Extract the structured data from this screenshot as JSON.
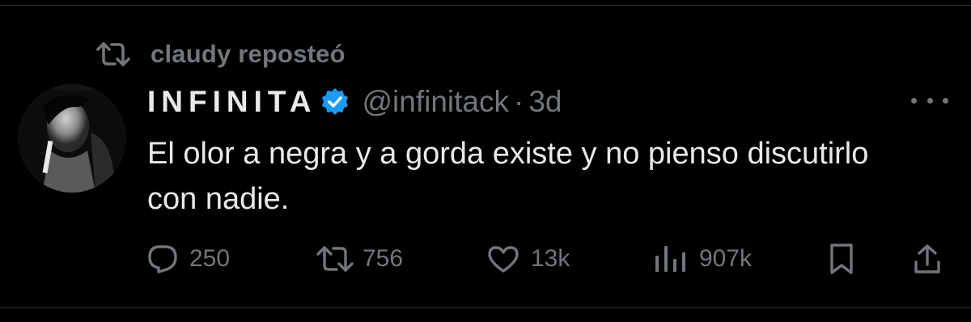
{
  "repost": {
    "label": "claudy reposteó",
    "icon": "repost-icon"
  },
  "tweet": {
    "author_name": "INFINITA",
    "handle": "@infinitack",
    "separator": "·",
    "time": "3d",
    "verified": true,
    "text": "El olor a negra y a gorda existe y no pienso discutirlo con nadie."
  },
  "actions": {
    "replies": "250",
    "reposts": "756",
    "likes": "13k",
    "views": "907k"
  },
  "colors": {
    "background": "#000000",
    "primary_text": "#e7e9ea",
    "secondary_text": "#71767b",
    "verified_blue": "#1d9bf0",
    "divider": "#2f3336"
  }
}
